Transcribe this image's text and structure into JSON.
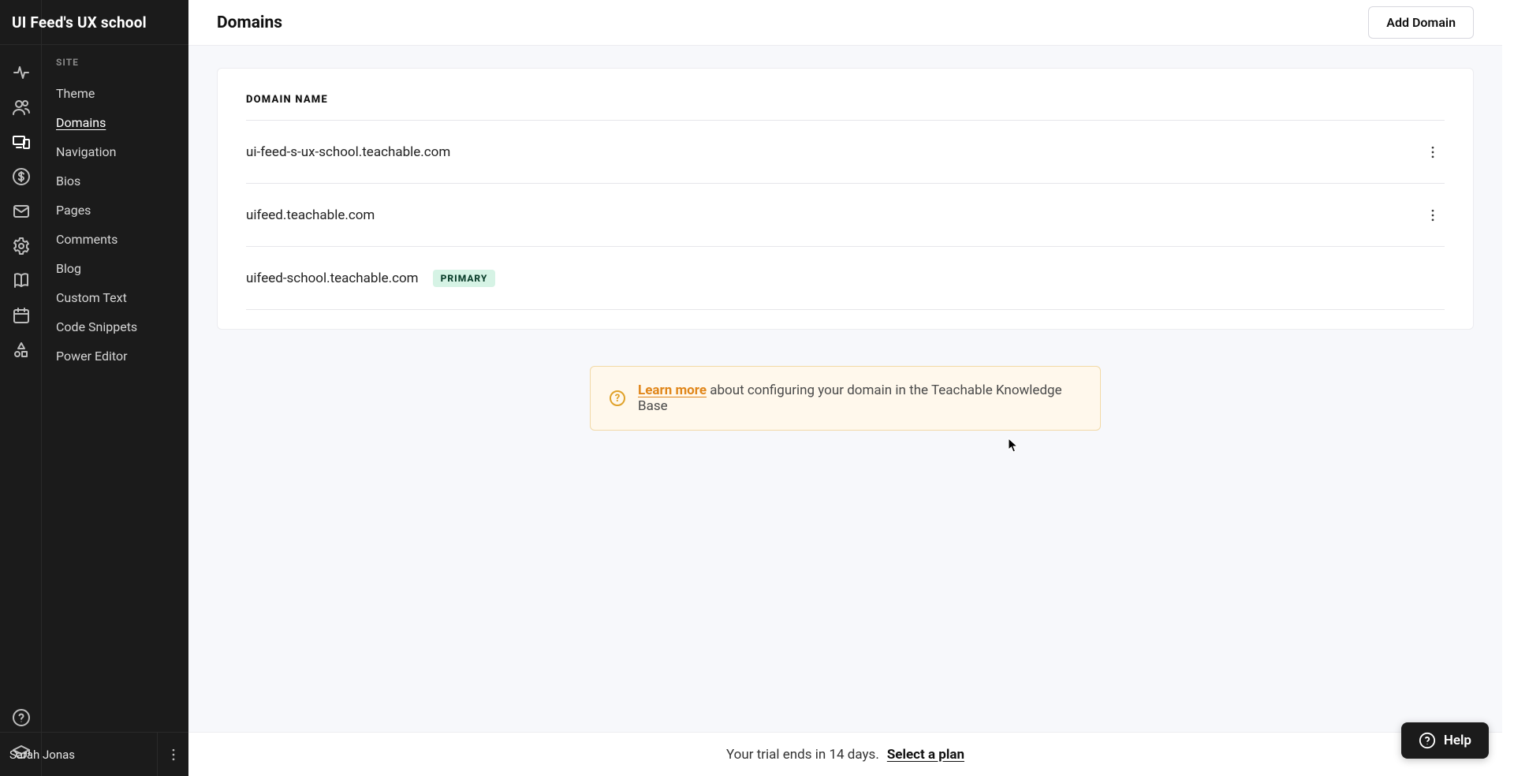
{
  "brand": "UI Feed's UX school",
  "page_title": "Domains",
  "add_button": "Add Domain",
  "sidebar": {
    "section_label": "SITE",
    "items": [
      {
        "label": "Theme"
      },
      {
        "label": "Domains"
      },
      {
        "label": "Navigation"
      },
      {
        "label": "Bios"
      },
      {
        "label": "Pages"
      },
      {
        "label": "Comments"
      },
      {
        "label": "Blog"
      },
      {
        "label": "Custom Text"
      },
      {
        "label": "Code Snippets"
      },
      {
        "label": "Power Editor"
      }
    ],
    "active_index": 1
  },
  "rail_icons": [
    {
      "name": "activity-icon"
    },
    {
      "name": "users-icon"
    },
    {
      "name": "devices-icon",
      "active": true
    },
    {
      "name": "dollar-icon"
    },
    {
      "name": "mail-icon"
    },
    {
      "name": "settings-icon"
    },
    {
      "name": "book-icon"
    },
    {
      "name": "calendar-icon"
    },
    {
      "name": "shapes-icon"
    }
  ],
  "rail_bottom_icons": [
    {
      "name": "help-circle-icon"
    },
    {
      "name": "graduation-icon"
    }
  ],
  "table": {
    "header": "DOMAIN NAME",
    "rows": [
      {
        "domain": "ui-feed-s-ux-school.teachable.com",
        "primary": false,
        "has_menu": true
      },
      {
        "domain": "uifeed.teachable.com",
        "primary": false,
        "has_menu": true
      },
      {
        "domain": "uifeed-school.teachable.com",
        "primary": true,
        "has_menu": false
      }
    ],
    "primary_badge": "PRIMARY"
  },
  "info_banner": {
    "learn_more": "Learn more",
    "rest": " about configuring your domain in the Teachable Knowledge Base"
  },
  "trial": {
    "text": "Your trial ends in 14 days.",
    "link": "Select a plan"
  },
  "user": {
    "name": "Sarah Jonas"
  },
  "help_fab": "Help"
}
